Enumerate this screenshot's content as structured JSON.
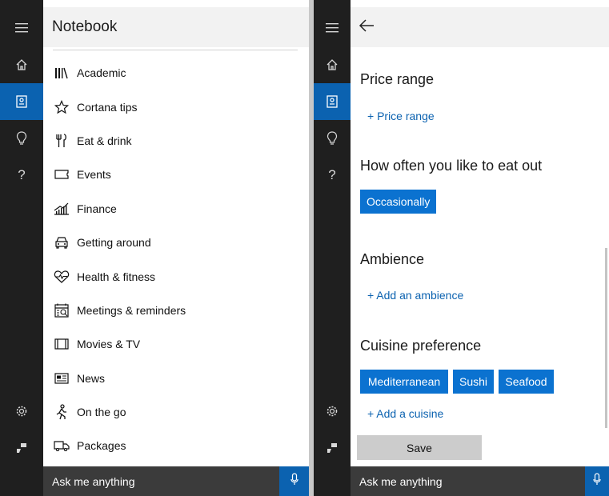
{
  "left_pane": {
    "header": {
      "title": "Notebook"
    },
    "rail": [
      {
        "name": "menu-icon"
      },
      {
        "name": "home-icon"
      },
      {
        "name": "notebook-icon",
        "active": true
      },
      {
        "name": "lightbulb-icon"
      },
      {
        "name": "help-icon",
        "glyph": "?"
      },
      {
        "name": "settings-icon"
      },
      {
        "name": "feedback-icon"
      }
    ],
    "notebook_items": [
      {
        "label": "Academic",
        "icon": "books-icon"
      },
      {
        "label": "Cortana tips",
        "icon": "star-icon"
      },
      {
        "label": "Eat & drink",
        "icon": "fork-knife-icon"
      },
      {
        "label": "Events",
        "icon": "ticket-icon"
      },
      {
        "label": "Finance",
        "icon": "chart-icon"
      },
      {
        "label": "Getting around",
        "icon": "car-icon"
      },
      {
        "label": "Health & fitness",
        "icon": "heartbeat-icon"
      },
      {
        "label": "Meetings & reminders",
        "icon": "calendar-icon"
      },
      {
        "label": "Movies & TV",
        "icon": "film-icon"
      },
      {
        "label": "News",
        "icon": "newspaper-icon"
      },
      {
        "label": "On the go",
        "icon": "walking-icon"
      },
      {
        "label": "Packages",
        "icon": "truck-icon"
      }
    ],
    "askbar": {
      "placeholder": "Ask me anything"
    }
  },
  "right_pane": {
    "help_glyph": "?",
    "sections": {
      "price_range": {
        "title": "Price range",
        "add_label": "+ Price range"
      },
      "eat_out": {
        "title": "How often you like to eat out",
        "selected": "Occasionally"
      },
      "ambience": {
        "title": "Ambience",
        "add_label": "+ Add an ambience"
      },
      "cuisine": {
        "title": "Cuisine preference",
        "chips": [
          "Mediterranean",
          "Sushi",
          "Seafood"
        ],
        "add_label": "+ Add a cuisine"
      }
    },
    "save_label": "Save",
    "askbar": {
      "placeholder": "Ask me anything"
    }
  },
  "colors": {
    "accent": "#0b62b0",
    "chip": "#0b72d0",
    "rail": "#1f1f1f",
    "askbar": "#3b3b3b"
  }
}
